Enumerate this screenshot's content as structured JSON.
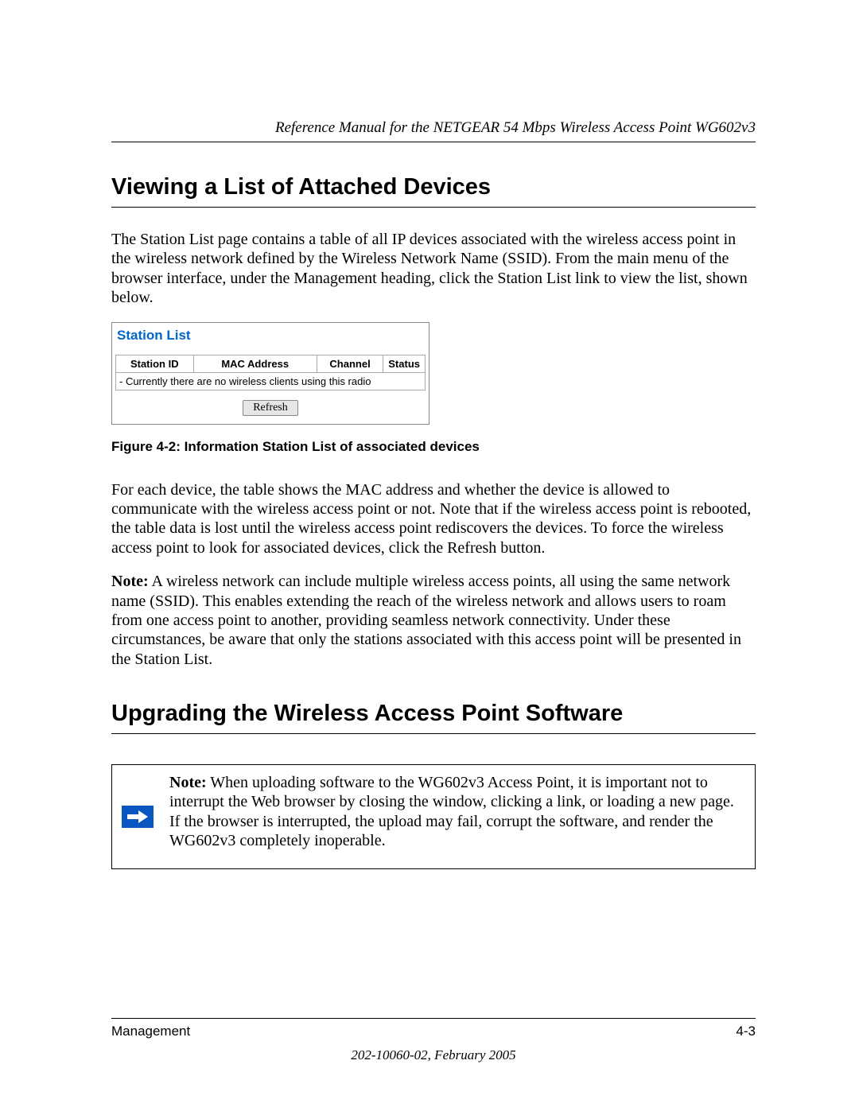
{
  "header": {
    "running_title": "Reference Manual for the NETGEAR 54 Mbps Wireless Access Point WG602v3"
  },
  "section1": {
    "title": "Viewing a List of Attached Devices",
    "p1": "The Station List page contains a table of all IP devices associated with the wireless access point in the wireless network defined by the Wireless Network Name (SSID). From the main menu of the browser interface, under the Management heading, click the Station List link to view the list, shown below."
  },
  "station_list": {
    "title": "Station List",
    "columns": {
      "c1": "Station ID",
      "c2": "MAC Address",
      "c3": "Channel",
      "c4": "Status"
    },
    "empty_row": "- Currently there are no wireless clients using this radio",
    "refresh_label": "Refresh"
  },
  "figure_caption": "Figure 4-2:  Information Station List of associated devices",
  "section1b": {
    "p2": "For each device, the table shows the MAC address and whether the device is allowed to communicate with the wireless access point or not. Note that if the wireless access point is rebooted, the table data is lost until the wireless access point rediscovers the devices. To force the wireless access point to look for associated devices, click the Refresh button.",
    "note_label": "Note:",
    "note_text": " A wireless network can include multiple wireless access points, all using the same network name (SSID). This enables extending the reach of the wireless network and allows users to roam from one access point to another, providing seamless network connectivity. Under these circumstances, be aware that only the stations associated with this access point will be presented in the Station List."
  },
  "section2": {
    "title": "Upgrading the Wireless Access Point Software"
  },
  "note_box": {
    "label": "Note:",
    "text": " When uploading software to the WG602v3 Access Point, it is important not to interrupt the Web browser by closing the window, clicking a link, or loading a new page. If the browser is interrupted, the upload may fail, corrupt the software, and render the WG602v3 completely inoperable."
  },
  "footer": {
    "section_name": "Management",
    "page_number": "4-3",
    "doc_id": "202-10060-02, February 2005"
  }
}
